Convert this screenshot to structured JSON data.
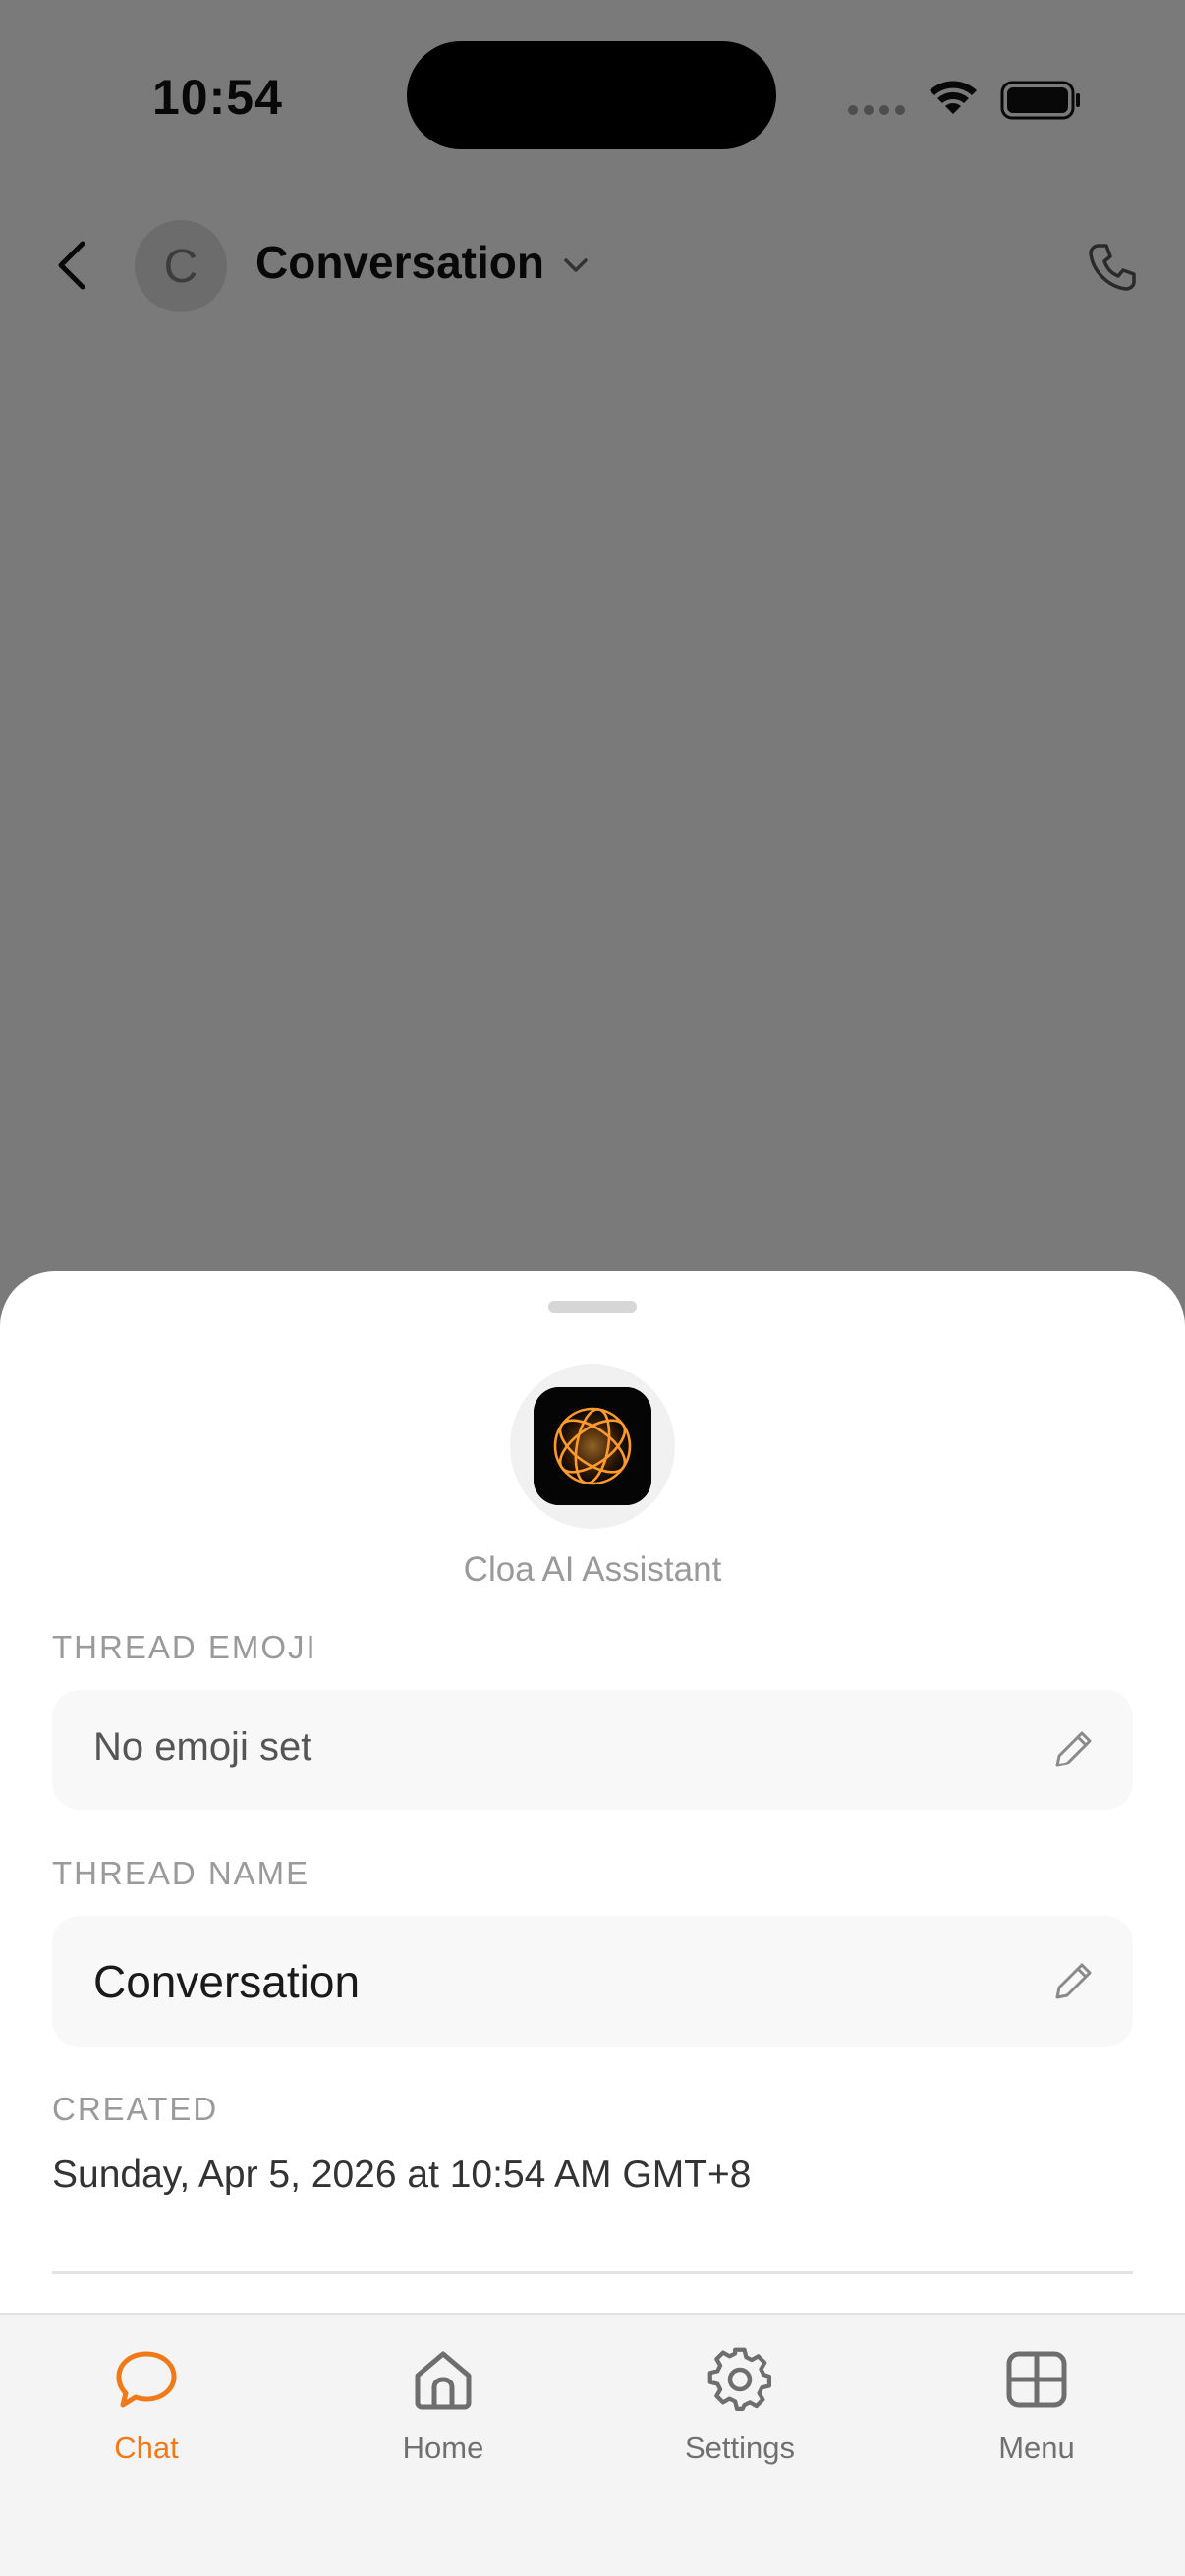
{
  "status_bar": {
    "time": "10:54"
  },
  "header": {
    "avatar_letter": "C",
    "title": "Conversation"
  },
  "sheet": {
    "assistant_name": "Cloa AI Assistant",
    "thread_emoji": {
      "label": "THREAD EMOJI",
      "value": "No emoji set"
    },
    "thread_name": {
      "label": "THREAD NAME",
      "value": "Conversation"
    },
    "created": {
      "label": "CREATED",
      "value": "Sunday, Apr 5, 2026 at 10:54 AM GMT+8"
    }
  },
  "tabbar": {
    "tabs": [
      {
        "label": "Chat",
        "icon": "chat-bubble-icon",
        "active": true
      },
      {
        "label": "Home",
        "icon": "home-icon",
        "active": false
      },
      {
        "label": "Settings",
        "icon": "gear-icon",
        "active": false
      },
      {
        "label": "Menu",
        "icon": "grid-icon",
        "active": false
      }
    ]
  },
  "colors": {
    "accent": "#f07a1a",
    "overlay": "rgba(0,0,0,0.5)",
    "sheet_background": "#ffffff",
    "field_background": "#f8f8f8"
  }
}
